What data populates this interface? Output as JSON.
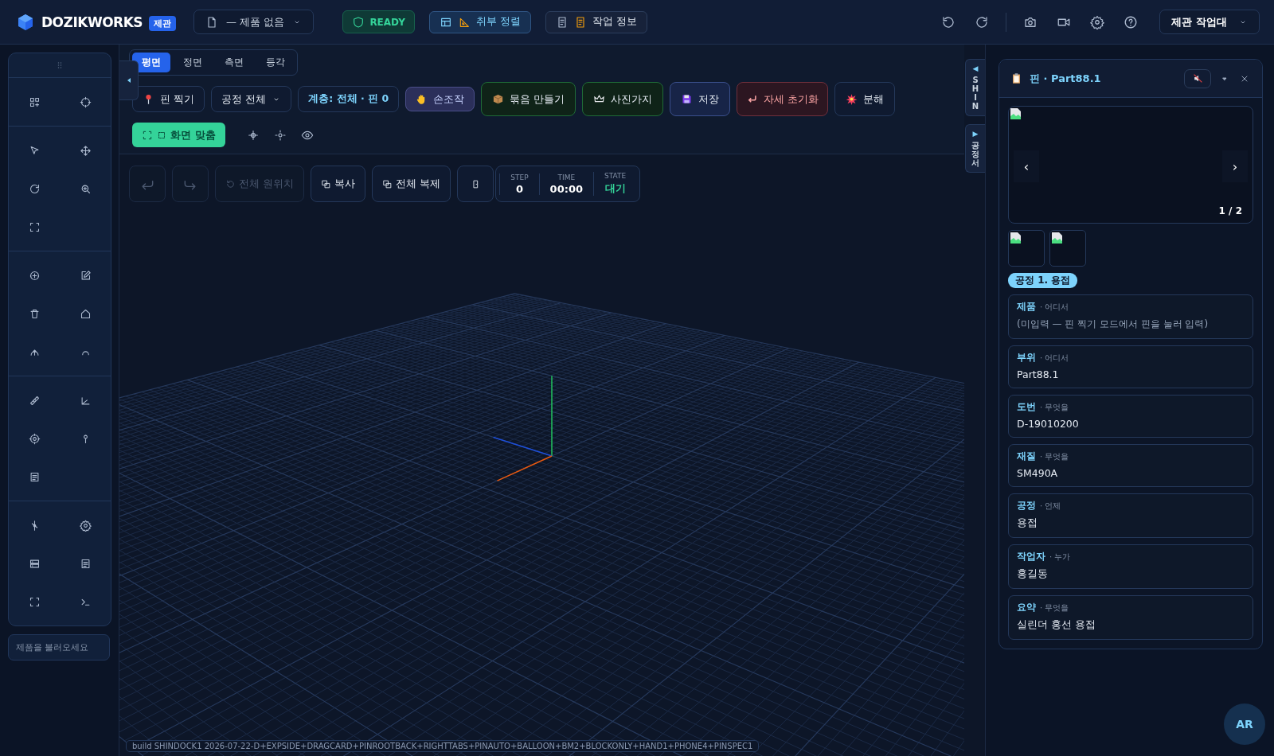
{
  "app": {
    "name": "DOZIKWORKS",
    "badge": "제관"
  },
  "product_select": {
    "value": "— 제품 없음"
  },
  "status": {
    "label": "READY"
  },
  "header_buttons": [
    {
      "label": "취부 정렬",
      "kind": "info"
    },
    {
      "label": "작업 정보",
      "kind": "plain"
    }
  ],
  "workstation_select": {
    "value": "제관 작업대"
  },
  "view_tabs": [
    {
      "label": "평면",
      "selected": true
    },
    {
      "label": "정면",
      "selected": false
    },
    {
      "label": "측면",
      "selected": false
    },
    {
      "label": "등각",
      "selected": false
    }
  ],
  "toolbar": [
    {
      "label": "핀 찍기",
      "kind": "plain"
    },
    {
      "label": "공정 전체",
      "kind": "select"
    },
    {
      "label": "계층: 전체 · 핀 0",
      "kind": "info"
    },
    {
      "label": "손조작",
      "kind": "active"
    },
    {
      "label": "묶음 만들기",
      "kind": "green"
    },
    {
      "label": "사진가지",
      "kind": "green"
    },
    {
      "label": "저장",
      "kind": "blue"
    },
    {
      "label": "자세 초기화",
      "kind": "red"
    },
    {
      "label": "분해",
      "kind": "plain"
    }
  ],
  "fit_button": {
    "label": "화면 맞춤"
  },
  "edit_bar": [
    {
      "kind": "undo",
      "disabled": true
    },
    {
      "kind": "redo",
      "disabled": true
    },
    {
      "label": "전체 원위치",
      "kind": "text",
      "disabled": true
    },
    {
      "label": "복사",
      "kind": "text",
      "disabled": false
    },
    {
      "label": "전체 복제",
      "kind": "text",
      "disabled": false
    },
    {
      "kind": "icon",
      "disabled": false
    }
  ],
  "stats": [
    {
      "label": "STEP",
      "value": "0",
      "kind": "plain"
    },
    {
      "label": "TIME",
      "value": "00:00",
      "kind": "plain"
    },
    {
      "label": "STATE",
      "value": "대기",
      "kind": "state"
    }
  ],
  "side_tabs": [
    {
      "label": "SHIN",
      "arrow": "◀"
    },
    {
      "label": "공정서",
      "arrow": "▶"
    }
  ],
  "panel": {
    "title": "핀 · Part88.1",
    "counter": "1 / 2",
    "prev": "‹",
    "next": "›",
    "tag": "공정 1. 용접",
    "fields": [
      {
        "label": "제품",
        "hint": "· 어디서",
        "value": "(미입력 — 핀 찍기 모드에서 핀을 눌러 입력)",
        "empty": true
      },
      {
        "label": "부위",
        "hint": "· 어디서",
        "value": "Part88.1",
        "empty": false
      },
      {
        "label": "도번",
        "hint": "· 무엇을",
        "value": "D-19010200",
        "empty": false
      },
      {
        "label": "재질",
        "hint": "· 무엇을",
        "value": "SM490A",
        "empty": false
      },
      {
        "label": "공정",
        "hint": "· 언제",
        "value": "용접",
        "empty": false
      },
      {
        "label": "작업자",
        "hint": "· 누가",
        "value": "홍길동",
        "empty": false
      },
      {
        "label": "요약",
        "hint": "· 무엇을",
        "value": "실린더 홍선 용접",
        "empty": false
      }
    ]
  },
  "load_field": {
    "placeholder": "제품을 불러오세요"
  },
  "build_info": "build SHINDOCK1 2026-07-22-D+EXPSIDE+DRAGCARD+PINROOTBACK+RIGHTTABS+PINAUTO+BALLOON+BM2+BLOCKONLY+HAND1+PHONE4+PINSPEC1",
  "ar_button": {
    "label": "AR"
  }
}
